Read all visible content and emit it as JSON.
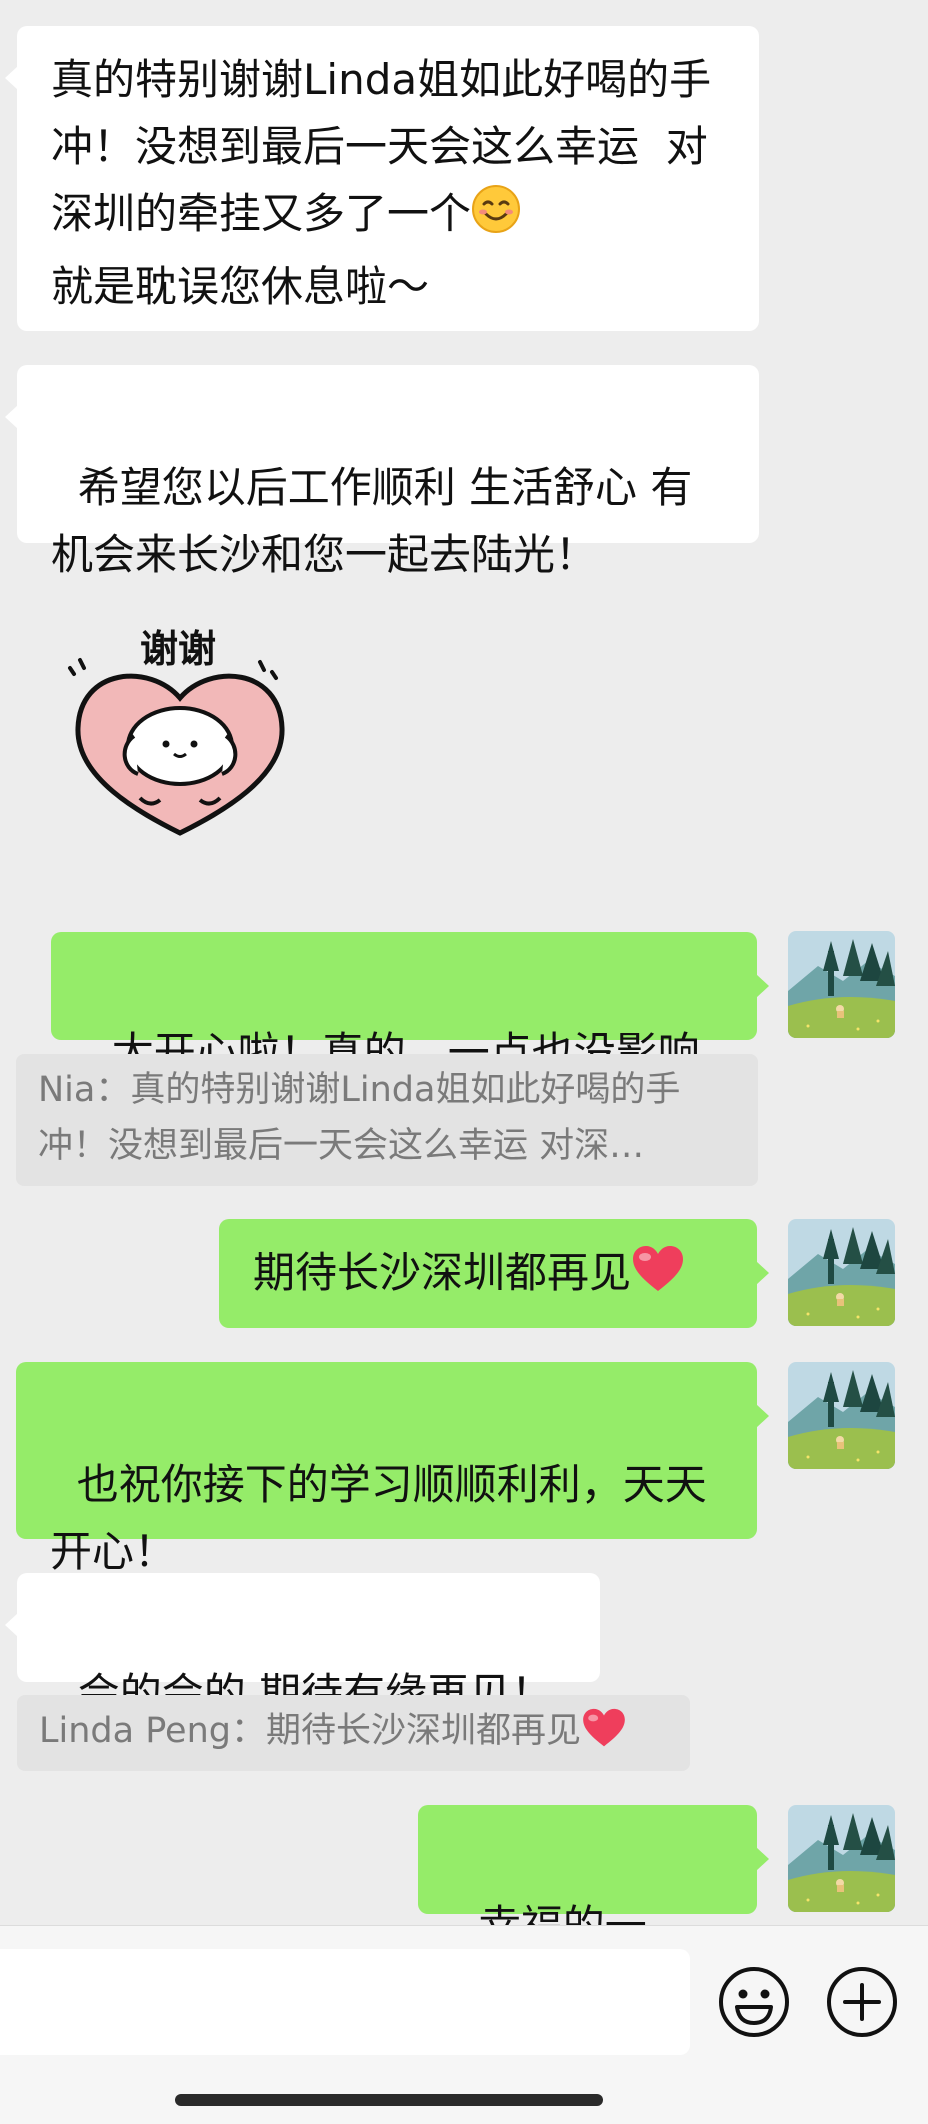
{
  "messages": [
    {
      "side": "in",
      "text": "真的特别谢谢Linda姐如此好喝的手冲！没想到最后一天会这么幸运  对深圳的牵挂又多了一个",
      "emoji": "smiling-face-emoji",
      "text_after": "就是耽误您休息啦～"
    },
    {
      "side": "in",
      "text": "希望您以后工作顺利 生活舒心 有机会来长沙和您一起去陆光！"
    },
    {
      "side": "in",
      "type": "sticker",
      "sticker_text": "谢谢"
    },
    {
      "side": "out",
      "text": "太开心啦！真的，一点也没影响"
    },
    {
      "type": "quote",
      "text": "Nia：真的特别谢谢Linda姐如此好喝的手冲！没想到最后一天会这么幸运  对深…"
    },
    {
      "side": "out",
      "text": "期待长沙深圳都再见",
      "emoji": "red-heart-emoji"
    },
    {
      "side": "out",
      "text": "也祝你接下的学习顺顺利利，天天开心！"
    },
    {
      "side": "in",
      "text": "会的会的 期待有缘再见！"
    },
    {
      "type": "quote",
      "text": "Linda Peng：期待长沙深圳都再见",
      "emoji": "red-heart-emoji"
    },
    {
      "side": "out",
      "text": "幸福的一天！"
    }
  ],
  "input": {
    "value": ""
  },
  "icons": {
    "emoji_button": "smiley-face-icon",
    "more_button": "plus-circle-icon"
  },
  "colors": {
    "background": "#EDEDED",
    "incoming_bubble": "#FFFFFF",
    "outgoing_bubble": "#95EC69",
    "quote_background": "#E3E3E3",
    "quote_text": "#7A7A7A"
  }
}
